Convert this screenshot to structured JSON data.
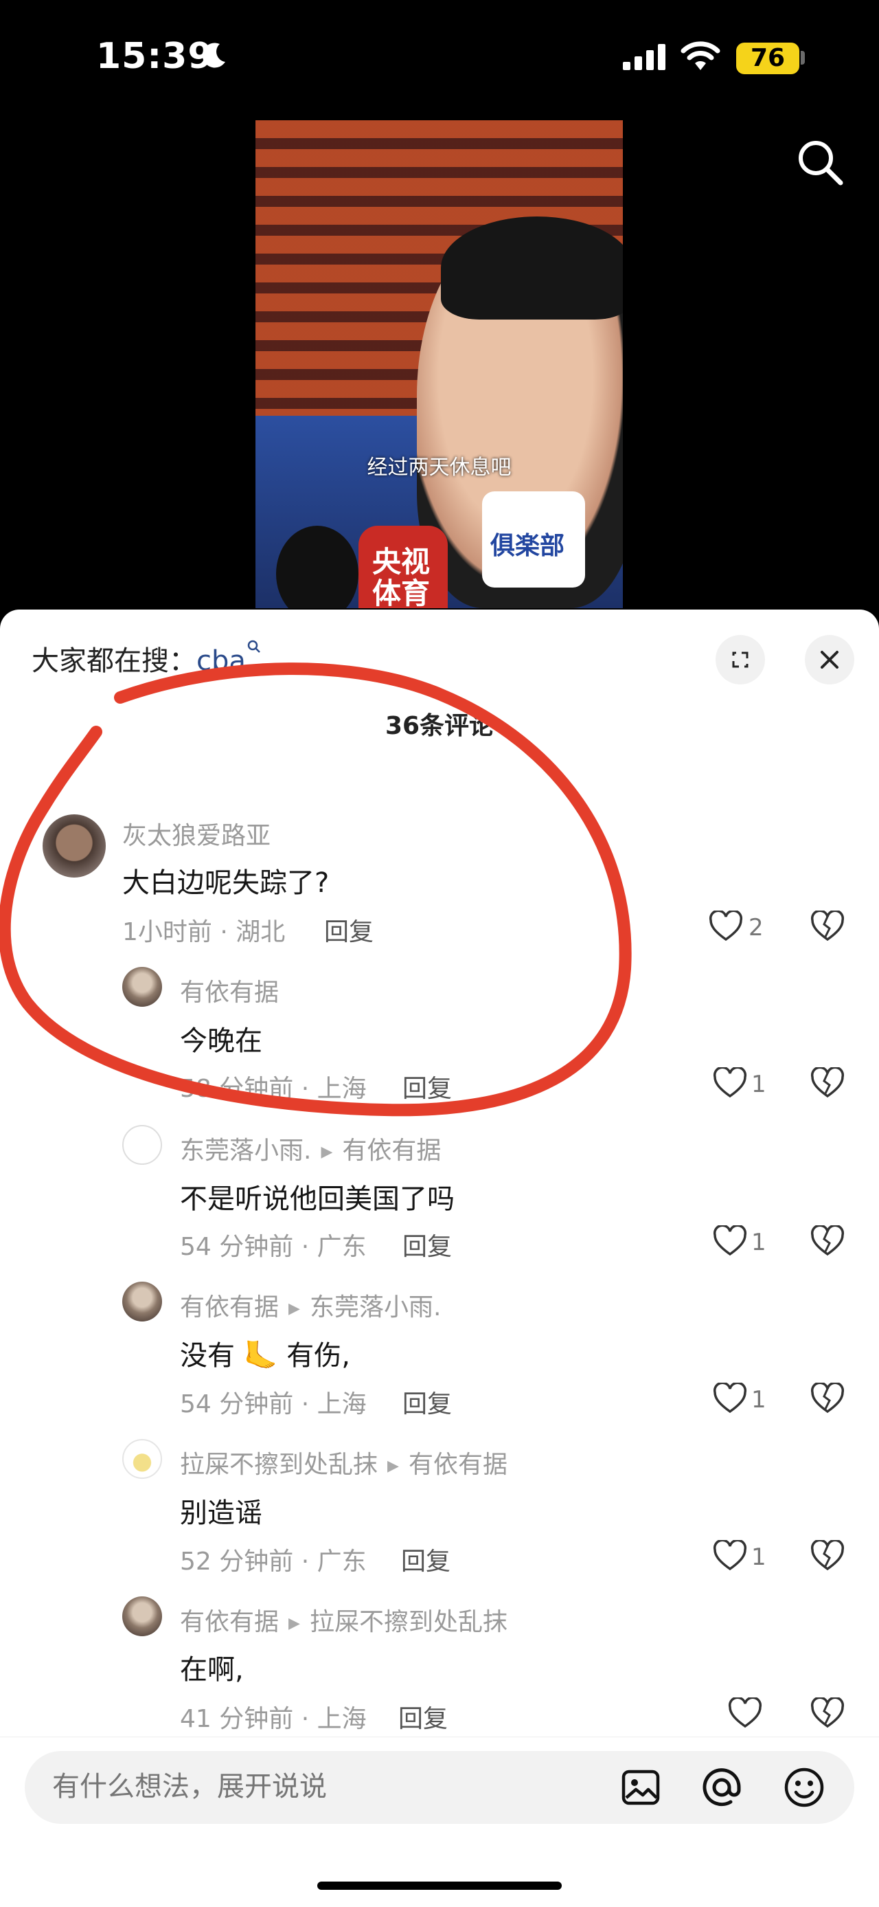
{
  "status_bar": {
    "time": "15:39",
    "battery": "76"
  },
  "video": {
    "subtitle": "经过两天休息吧",
    "mic_left": "央视体育",
    "mic_right": "俱楽部"
  },
  "sheet": {
    "hot_search_prefix": "大家都在搜：",
    "hot_search_keyword": "cba",
    "comment_count": "36条评论"
  },
  "comments": [
    {
      "user": "灰太狼爱路亚",
      "text": "大白边呢失踪了?",
      "time_loc": "1小时前 · 湖北",
      "reply": "回复",
      "likes": "2"
    },
    {
      "user": "有依有据",
      "text": "今晚在",
      "time_loc": "58 分钟前 · 上海",
      "reply": "回复",
      "likes": "1"
    },
    {
      "user": "东莞落小雨.",
      "reply_to": "有依有据",
      "text": "不是听说他回美国了吗",
      "time_loc": "54 分钟前 · 广东",
      "reply": "回复",
      "likes": "1"
    },
    {
      "user": "有依有据",
      "reply_to": "东莞落小雨.",
      "text": "没有 🦶 有伤,",
      "time_loc": "54 分钟前 · 上海",
      "reply": "回复",
      "likes": "1"
    },
    {
      "user": "拉屎不擦到处乱抹",
      "reply_to": "有依有据",
      "text": "别造谣",
      "time_loc": "52 分钟前 · 广东",
      "reply": "回复",
      "likes": "1"
    },
    {
      "user": "有依有据",
      "reply_to": "拉屎不擦到处乱抹",
      "text": "在啊,",
      "time_loc": "41 分钟前 · 上海",
      "reply": "回复",
      "likes": ""
    }
  ],
  "input": {
    "placeholder": "有什么想法，展开说说"
  },
  "icons": {
    "image": "image-icon",
    "mention": "at-icon",
    "emoji": "emoji-icon",
    "like": "heart-icon",
    "dislike": "broken-heart-icon"
  },
  "colors": {
    "annotation": "#e43e2b",
    "keyword": "#2a4a8a",
    "battery": "#f5d31a"
  }
}
